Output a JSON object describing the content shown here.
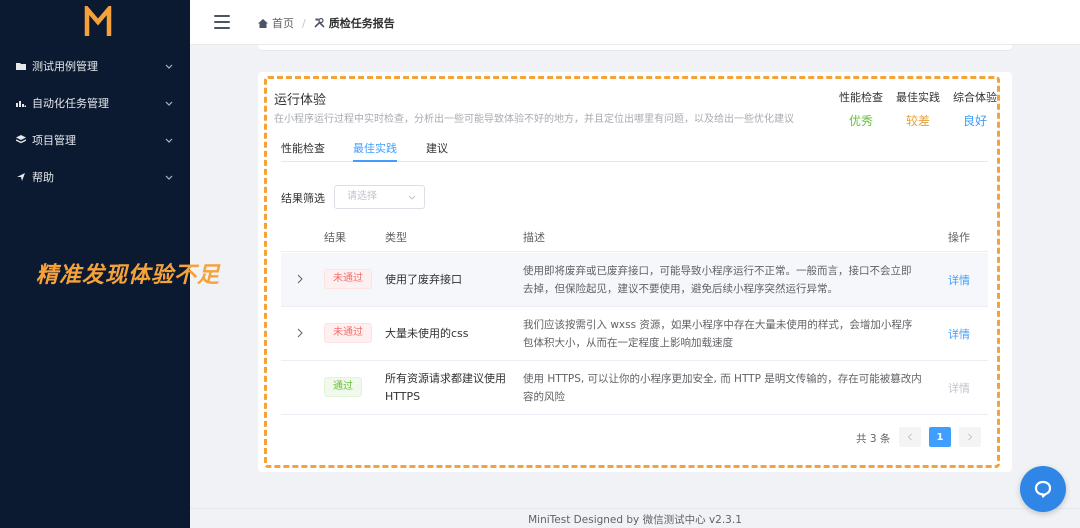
{
  "app": {
    "logo_letter": "M",
    "logo_color": "#f6a23a"
  },
  "sidebar": {
    "items": [
      {
        "label": "测试用例管理",
        "icon": "folder-icon"
      },
      {
        "label": "自动化任务管理",
        "icon": "bar-chart-icon"
      },
      {
        "label": "项目管理",
        "icon": "layers-icon"
      },
      {
        "label": "帮助",
        "icon": "compass-icon"
      }
    ]
  },
  "callout": "精准发现体验不足",
  "header": {
    "breadcrumb": [
      {
        "label": "首页",
        "icon": "home-icon"
      },
      {
        "label": "质检任务报告",
        "icon": "tools-icon"
      }
    ]
  },
  "report": {
    "title": "运行体验",
    "subtitle": "在小程序运行过程中实时检查，分析出一些可能导致体验不好的地方，并且定位出哪里有问题，以及给出一些优化建议",
    "metrics": [
      {
        "label": "性能检查",
        "value": "优秀",
        "color": "#67c23a"
      },
      {
        "label": "最佳实践",
        "value": "较差",
        "color": "#e6a23c"
      },
      {
        "label": "综合体验",
        "value": "良好",
        "color": "#409eff"
      }
    ],
    "tabs": [
      {
        "label": "性能检查",
        "active": false
      },
      {
        "label": "最佳实践",
        "active": true
      },
      {
        "label": "建议",
        "active": false
      }
    ],
    "filter": {
      "label": "结果筛选",
      "placeholder": "请选择"
    },
    "table": {
      "headers": {
        "result": "结果",
        "type": "类型",
        "desc": "描述",
        "op": "操作"
      },
      "rows": [
        {
          "result": "未通过",
          "status": "fail",
          "type": "使用了废弃接口",
          "desc_1": "使用即将废弃或已废弃接口，可能导致小程序运行不正常。一般而言，接口不会立即",
          "desc_2": "去掉，但保险起见，建议不要使用，避免后续小程序突然运行异常。",
          "op": "详情",
          "expandable": true
        },
        {
          "result": "未通过",
          "status": "fail",
          "type": "大量未使用的css",
          "desc_1": "我们应该按需引入 wxss 资源，如果小程序中存在大量未使用的样式，会增加小程序",
          "desc_2": "包体积大小，从而在一定程度上影响加载速度",
          "op": "详情",
          "expandable": true
        },
        {
          "result": "通过",
          "status": "pass",
          "type_1": "所有资源请求都建议使用",
          "type_2": "HTTPS",
          "desc_1": "使用 HTTPS, 可以让你的小程序更加安全, 而 HTTP 是明文传输的，存在可能被篡改内",
          "desc_2": "容的风险",
          "op": "详情",
          "expandable": false
        }
      ]
    },
    "pagination": {
      "total_text": "共 3 条",
      "current_page": "1"
    }
  },
  "footer": {
    "text": "MiniTest Designed by 微信测试中心 v2.3.1"
  }
}
